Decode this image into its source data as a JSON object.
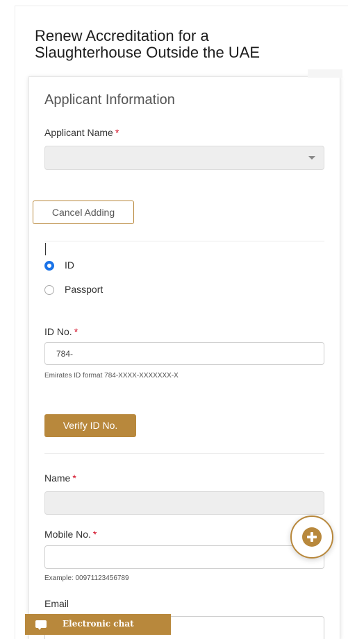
{
  "page": {
    "title": "Renew Accreditation for a Slaughterhouse Outside the UAE"
  },
  "section": {
    "title": "Applicant Information"
  },
  "applicant_name": {
    "label": "Applicant Name",
    "required_mark": "*",
    "value": ""
  },
  "cancel_button": {
    "label": "Cancel Adding"
  },
  "id_type": {
    "options": [
      {
        "label": "ID",
        "selected": true
      },
      {
        "label": "Passport",
        "selected": false
      }
    ]
  },
  "id_number": {
    "label": "ID No.",
    "required_mark": "*",
    "value": "784-",
    "help": "Emirates ID format 784-XXXX-XXXXXXX-X"
  },
  "verify_button": {
    "label": "Verify ID No."
  },
  "name": {
    "label": "Name",
    "required_mark": "*",
    "value": ""
  },
  "mobile": {
    "label": "Mobile No.",
    "required_mark": "*",
    "value": "",
    "help": "Example: 00971123456789"
  },
  "email": {
    "label": "Email",
    "value": ""
  },
  "chat": {
    "label": "Electronic chat"
  },
  "icons": {
    "add": "plus-circle-icon",
    "chat": "chat-bubble-icon",
    "dropdown": "chevron-down-icon"
  },
  "colors": {
    "accent": "#b8883c",
    "radio_selected": "#1a73e8",
    "required": "#d0021b"
  }
}
